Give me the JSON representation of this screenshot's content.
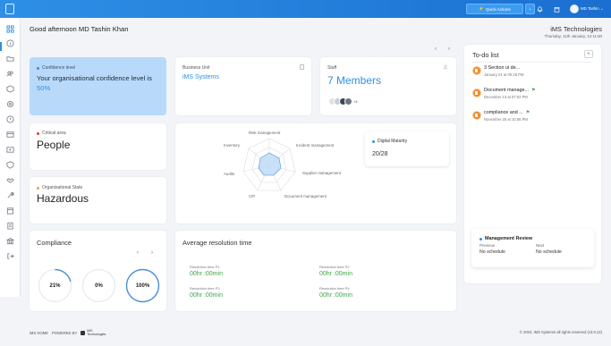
{
  "topbar": {
    "quick_actions_label": "Quick Actions",
    "user_name": "MD Tashin",
    "icons": [
      "app-logo-icon",
      "bell-icon",
      "calendar-icon",
      "chevron-down-icon"
    ]
  },
  "sidebar": {
    "items": [
      "dashboard",
      "info",
      "folder",
      "users",
      "box",
      "settings",
      "alert",
      "report",
      "video",
      "shield",
      "handshake",
      "tools",
      "calendar",
      "clipboard",
      "bank",
      "logout"
    ]
  },
  "header": {
    "greeting": "Good afternoon MD Tashin Khan",
    "company": "iMS Technologies",
    "date": "Thursday, 11th January, 14:11:50"
  },
  "confidence": {
    "label": "Confidence level",
    "text": "Your organisational confidence level is ",
    "value": "50%"
  },
  "business_unit": {
    "label": "Business Unit",
    "value": "iMS Systems"
  },
  "staff": {
    "label": "Staff",
    "value": "7 Members",
    "more": "+4"
  },
  "critical_area": {
    "label": "Critical area",
    "value": "People"
  },
  "org_state": {
    "label": "Organisational State",
    "value": "Hazardous"
  },
  "radar": {
    "axes": [
      "Risk management",
      "Incident management",
      "Supplier management",
      "Document management",
      "CIP",
      "Audits",
      "Inventory"
    ]
  },
  "digital_maturity": {
    "label": "Digital Maturity",
    "value": "20/28"
  },
  "compliance": {
    "title": "Compliance",
    "gauges": [
      {
        "label": "21%",
        "value": 0.21
      },
      {
        "label": "0%",
        "value": 0.0
      },
      {
        "label": "100%",
        "value": 1.0
      }
    ]
  },
  "avg_resolution": {
    "title": "Average resolution time",
    "items": [
      {
        "label": "Resolution time P1",
        "value": "00hr :00min"
      },
      {
        "label": "Resolution time P2",
        "value": "00hr :00min"
      },
      {
        "label": "Resolution time P3",
        "value": "00hr :00min"
      },
      {
        "label": "Resolution time P4",
        "value": "00hr :00min"
      }
    ]
  },
  "todo": {
    "title": "To-do list",
    "add_label": "+",
    "items": [
      {
        "name": "3 Section ui de...",
        "date": "January 01 at 05:25 PM"
      },
      {
        "name": "Document manage...",
        "date": "December 13 at 07:02 PM"
      },
      {
        "name": "compliance and ...",
        "date": "November 25 at 10:56 PM"
      }
    ]
  },
  "management_review": {
    "label": "Management Review",
    "previous_label": "Previous",
    "next_label": "Next",
    "previous_value": "No schedule",
    "next_value": "No schedule"
  },
  "footer": {
    "home": "iMS HOME",
    "powered": "POWERED BY",
    "logo_line1": "iMS",
    "logo_line2": "Technologies",
    "copyright": "© 2024. iMS Systems all rights reserved (v3.0.12)"
  },
  "colors": {
    "accent": "#2e8fe6",
    "confidence_bg": "#b9d9fb",
    "critical_dot": "#e23b3b",
    "org_dot": "#f2a23a",
    "todo_icon": "#ef8a2c",
    "resolution_value": "#3fa64a"
  }
}
